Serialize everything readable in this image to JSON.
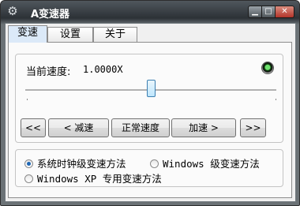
{
  "window": {
    "title": "A变速器",
    "icon": "gear-icon",
    "controls": {
      "minimize": "▁",
      "maximize": "□",
      "close": "✕"
    }
  },
  "tabs": [
    {
      "label": "变速",
      "active": true
    },
    {
      "label": "设置",
      "active": false
    },
    {
      "label": "关于",
      "active": false
    }
  ],
  "speed_panel": {
    "current_speed_label": "当前速度:",
    "current_speed_value": "1.0000X",
    "indicator_color": "#2ecc40",
    "slider_position_fraction": 0.5
  },
  "buttons": {
    "first": "<<",
    "decrease": "< 减速",
    "normal": "正常速度",
    "increase": "加速 >",
    "last": ">>"
  },
  "methods": {
    "options": [
      {
        "label": "系统时钟级变速方法",
        "checked": true
      },
      {
        "label": "Windows 级变速方法",
        "checked": false
      },
      {
        "label": "Windows XP 专用变速方法",
        "checked": false
      }
    ]
  }
}
